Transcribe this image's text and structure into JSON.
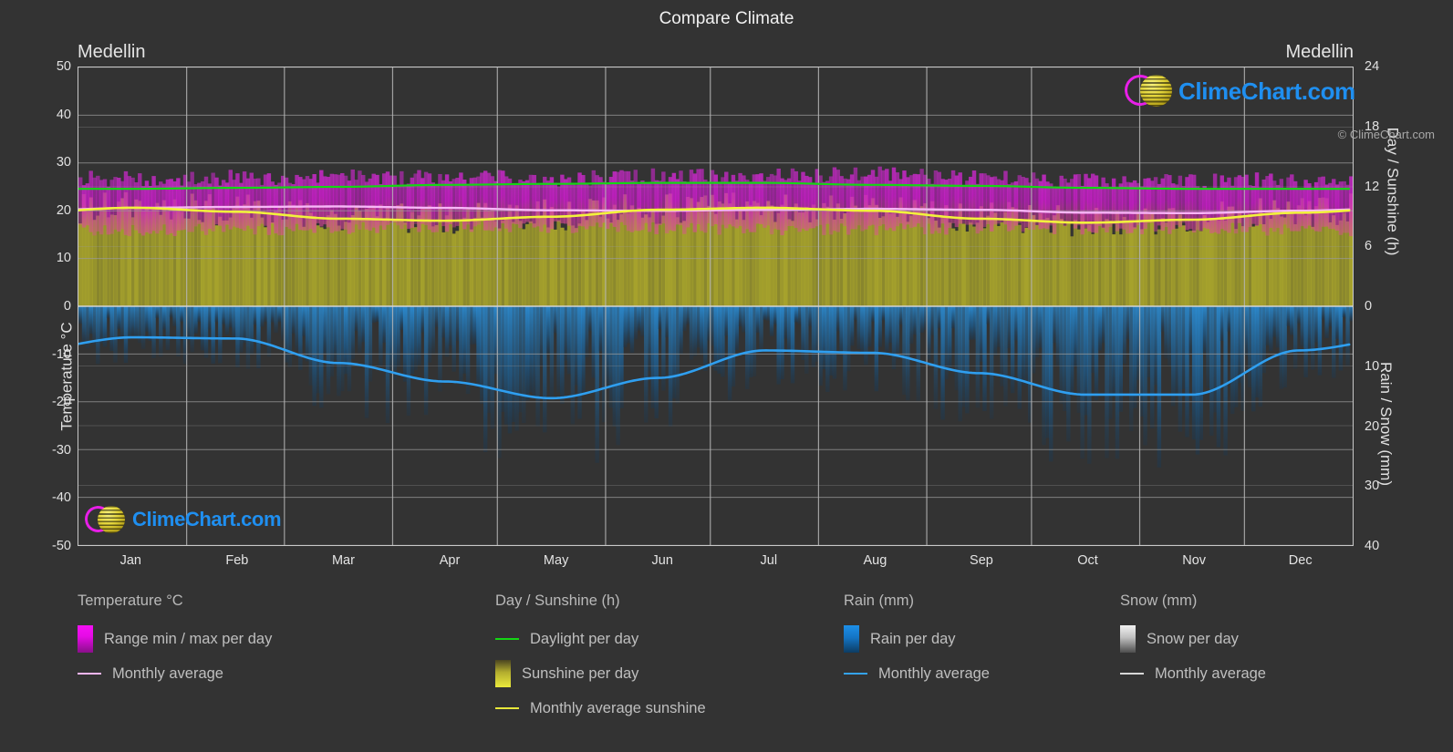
{
  "header": {
    "title": "Compare Climate",
    "city_left": "Medellin",
    "city_right": "Medellin"
  },
  "axes": {
    "left_title": "Temperature °C",
    "right_title_top": "Day / Sunshine (h)",
    "right_title_bottom": "Rain / Snow (mm)",
    "left_ticks": [
      "50",
      "40",
      "30",
      "20",
      "10",
      "0",
      "-10",
      "-20",
      "-30",
      "-40",
      "-50"
    ],
    "right_ticks_top": [
      "24",
      "18",
      "12",
      "6",
      "0"
    ],
    "right_ticks_bottom": [
      "10",
      "20",
      "30",
      "40"
    ],
    "x_ticks": [
      "Jan",
      "Feb",
      "Mar",
      "Apr",
      "May",
      "Jun",
      "Jul",
      "Aug",
      "Sep",
      "Oct",
      "Nov",
      "Dec"
    ]
  },
  "legend": {
    "groups": [
      {
        "title": "Temperature °C",
        "items": [
          {
            "label": "Range min / max per day",
            "marker": "swatch",
            "swatch_class": "sw-temp",
            "color": "#e60be6"
          },
          {
            "label": "Monthly average",
            "marker": "line",
            "color": "#f7b6f7"
          }
        ]
      },
      {
        "title": "Day / Sunshine (h)",
        "items": [
          {
            "label": "Daylight per day",
            "marker": "line",
            "color": "#14d614"
          },
          {
            "label": "Sunshine per day",
            "marker": "swatch",
            "swatch_class": "sw-sun",
            "color": "#d9d93c"
          },
          {
            "label": "Monthly average sunshine",
            "marker": "line",
            "color": "#e8e83a"
          }
        ]
      },
      {
        "title": "Rain (mm)",
        "items": [
          {
            "label": "Rain per day",
            "marker": "swatch",
            "swatch_class": "sw-rain",
            "color": "#1789e0"
          },
          {
            "label": "Monthly average",
            "marker": "line",
            "color": "#34a3f0"
          }
        ]
      },
      {
        "title": "Snow (mm)",
        "items": [
          {
            "label": "Snow per day",
            "marker": "swatch",
            "swatch_class": "sw-snow",
            "color": "#d0d0d0"
          },
          {
            "label": "Monthly average",
            "marker": "line",
            "color": "#d8d8d8"
          }
        ]
      }
    ],
    "copyright": "© ClimeChart.com"
  },
  "watermark": {
    "text": "ClimeChart.com"
  },
  "colors": {
    "background": "#333333",
    "grid": "#8c8c8c",
    "axis": "#c9c9c9",
    "text": "#e4e4e4",
    "temp_range": "#e60be6",
    "temp_avg": "#f7b6f7",
    "daylight": "#14d614",
    "sunshine": "#c6c233",
    "sunshine_avg": "#f2f23c",
    "rain": "#1e7fc4",
    "rain_avg": "#2f9ff0",
    "logo_blue": "#1f8ff0",
    "logo_magenta": "#e81fe8",
    "logo_yellow": "#ddcf3a"
  },
  "chart_data": {
    "type": "area",
    "title": "Compare Climate",
    "subtitle": "Medellin",
    "xlabel": "",
    "ylabel": "Temperature °C",
    "grid": true,
    "legend_position": "bottom",
    "categories": [
      "Jan",
      "Feb",
      "Mar",
      "Apr",
      "May",
      "Jun",
      "Jul",
      "Aug",
      "Sep",
      "Oct",
      "Nov",
      "Dec"
    ],
    "axis_left": {
      "label": "Temperature °C",
      "min": -50,
      "max": 50,
      "ticks": [
        50,
        40,
        30,
        20,
        10,
        0,
        -10,
        -20,
        -30,
        -40,
        -50
      ]
    },
    "axis_right_top": {
      "label": "Day / Sunshine (h)",
      "min": 0,
      "max": 24,
      "ticks": [
        0,
        6,
        12,
        18,
        24
      ]
    },
    "axis_right_bottom": {
      "label": "Rain / Snow (mm)",
      "min": 0,
      "max": 40,
      "ticks": [
        0,
        10,
        20,
        30,
        40
      ]
    },
    "series": [
      {
        "name": "Monthly average temperature",
        "unit": "°C",
        "axis": "left",
        "color": "#f7b6f7",
        "values": [
          20.6,
          20.7,
          20.9,
          20.7,
          20.2,
          19.9,
          19.7,
          20.1,
          20.6,
          20.6,
          20.2,
          18.2,
          17.6,
          19.4
        ]
      },
      {
        "name": "Monthly average temperature (monthly)",
        "unit": "°C",
        "axis": "left",
        "color": "#f7b6f7",
        "values": [
          20.6,
          20.8,
          20.9,
          20.6,
          20.1,
          20.0,
          20.2,
          20.4,
          20.2,
          19.6,
          19.5,
          20.0
        ]
      },
      {
        "name": "Daily temperature range max",
        "unit": "°C",
        "axis": "left",
        "color": "#e60be6",
        "values": [
          26.5,
          26.6,
          26.8,
          26.6,
          26.5,
          26.9,
          27.2,
          27.3,
          26.6,
          25.8,
          25.8,
          26.2
        ]
      },
      {
        "name": "Daily temperature range min",
        "unit": "°C",
        "axis": "left",
        "color": "#e60be6",
        "values": [
          15.8,
          16.0,
          16.4,
          16.7,
          16.6,
          16.3,
          16.0,
          16.1,
          16.3,
          16.3,
          16.3,
          16.0
        ]
      },
      {
        "name": "Daylight per day",
        "unit": "h",
        "axis": "right_top",
        "color": "#14d614",
        "values": [
          11.8,
          11.9,
          12.0,
          12.2,
          12.3,
          12.4,
          12.4,
          12.2,
          12.1,
          11.9,
          11.8,
          11.8
        ]
      },
      {
        "name": "Monthly average sunshine",
        "unit": "h",
        "axis": "right_top",
        "color": "#f2f23c",
        "values": [
          9.9,
          9.8,
          9.3,
          8.8,
          8.6,
          8.6,
          9.5,
          9.7,
          9.9,
          9.6,
          9.0,
          8.5,
          8.4,
          9.4
        ]
      },
      {
        "name": "Sunshine per day",
        "unit": "h",
        "axis": "right_top",
        "color": "#c6c233",
        "values": [
          9.9,
          9.5,
          8.8,
          8.6,
          9.0,
          9.7,
          9.9,
          9.6,
          8.8,
          8.4,
          8.7,
          9.4
        ]
      },
      {
        "name": "Monthly average rain",
        "unit": "mm",
        "axis": "right_bottom",
        "color": "#2f9ff0",
        "values": [
          5.2,
          5.4,
          9.5,
          12.6,
          15.4,
          12.0,
          7.4,
          7.8,
          11.2,
          14.8,
          14.8,
          7.4
        ]
      },
      {
        "name": "Snow per day",
        "unit": "mm",
        "axis": "right_bottom",
        "color": "#d0d0d0",
        "values": [
          0,
          0,
          0,
          0,
          0,
          0,
          0,
          0,
          0,
          0,
          0,
          0
        ]
      }
    ]
  }
}
